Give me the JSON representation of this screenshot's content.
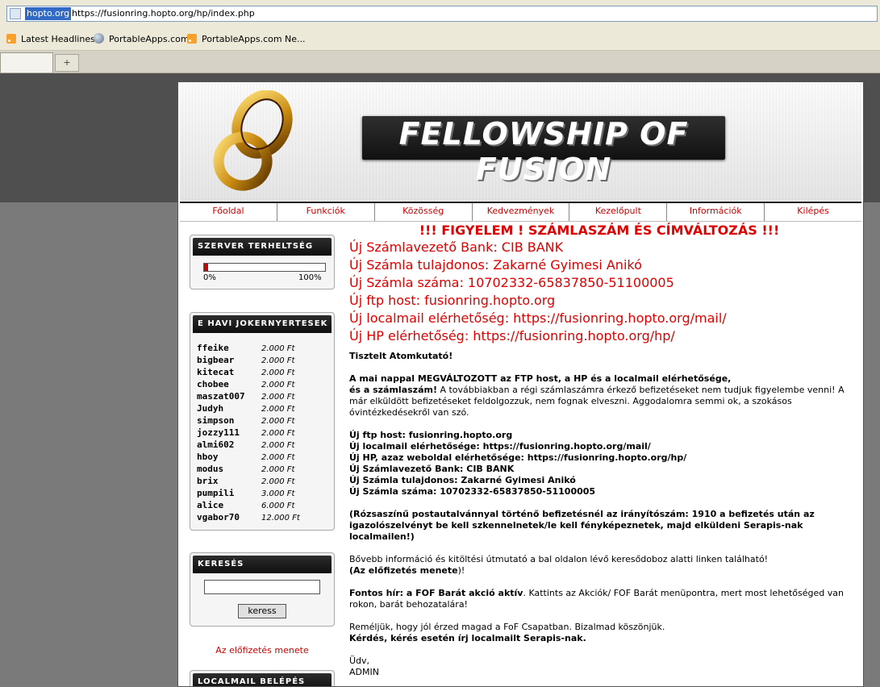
{
  "browser": {
    "host_highlight": "hopto.org",
    "url": "https://fusionring.hopto.org/hp/index.php",
    "bookmarks": [
      "Latest Headlines",
      "PortableApps.com",
      "PortableApps.com Ne..."
    ],
    "new_tab_symbol": "+"
  },
  "header": {
    "banner_text": "FELLOWSHIP OF FUSION"
  },
  "nav": [
    "Főoldal",
    "Funkciók",
    "Közösség",
    "Kedvezmények",
    "Kezelőpult",
    "Információk",
    "Kilépés"
  ],
  "sidebar": {
    "load_box": {
      "title": "SZERVER TERHELTSÉG",
      "min_label": "0%",
      "max_label": "100%",
      "load_fraction": 0.03
    },
    "winners_box": {
      "title": "E HAVI JOKERNYERTESEK",
      "rows": [
        {
          "name": "ffeike",
          "amount": "2.000 Ft"
        },
        {
          "name": "bigbear",
          "amount": "2.000 Ft"
        },
        {
          "name": "kitecat",
          "amount": "2.000 Ft"
        },
        {
          "name": "chobee",
          "amount": "2.000 Ft"
        },
        {
          "name": "maszat007",
          "amount": "2.000 Ft"
        },
        {
          "name": "Judyh",
          "amount": "2.000 Ft"
        },
        {
          "name": "simpson",
          "amount": "2.000 Ft"
        },
        {
          "name": "jozzy111",
          "amount": "2.000 Ft"
        },
        {
          "name": "almi602",
          "amount": "2.000 Ft"
        },
        {
          "name": "hboy",
          "amount": "2.000 Ft"
        },
        {
          "name": "modus",
          "amount": "2.000 Ft"
        },
        {
          "name": "brix",
          "amount": "2.000 Ft"
        },
        {
          "name": "pumpili",
          "amount": "3.000 Ft"
        },
        {
          "name": "alice",
          "amount": "6.000 Ft"
        },
        {
          "name": "vgabor70",
          "amount": "12.000 Ft"
        }
      ]
    },
    "search_box": {
      "title": "KERESÉS",
      "input_value": "",
      "button_label": "keress"
    },
    "subscription_link": "Az előfizetés menete",
    "localmail_box": {
      "title": "LOCALMAIL BELÉPÉS"
    }
  },
  "main": {
    "warning_title": "!!! FIGYELEM ! SZÁMLASZÁM ÉS CÍMVÁLTOZÁS !!!",
    "red_lines": [
      "Új Számlavezető Bank: CIB BANK",
      "Új Számla tulajdonos: Zakarné Gyimesi Anikó",
      "Új Számla száma: 10702332-65837850-51100005",
      "Új ftp host: fusionring.hopto.org",
      "Új localmail elérhetőség: https://fusionring.hopto.org/mail/",
      "Új HP elérhetőség: https://fusionring.hopto.org/hp/"
    ],
    "greeting": "Tisztelt Atomkutató!",
    "para1_bold1": "A mai nappal MEGVÁLTOZOTT az FTP host, a HP és a localmail elérhetősége,",
    "para1_bold2": "és a számlaszám!",
    "para1_rest": " A továbbiakban a régi számlaszámra érkező befizetéseket nem tudjuk figyelembe venni! A már elküldött befizetéseket feldolgozzuk, nem fognak elveszni. Aggodalomra semmi ok, a szokásos óvintézkedésekről van szó.",
    "details": [
      "Új ftp host: fusionring.hopto.org",
      "Új localmail elérhetősége: https://fusionring.hopto.org/mail/",
      "Új HP, azaz weboldal elérhetősége: https://fusionring.hopto.org/hp/",
      "Új Számlavezető Bank: CIB BANK",
      "Új Számla tulajdonos: Zakarné Gyimesi Anikó",
      "Új Számla száma: 10702332-65837850-51100005"
    ],
    "postal_note": "(Rózsaszínű postautalvánnyal történő befizetésnél az irányítószám: 1910 a befizetés után az igazolószelvényt be kell szkennelnetek/le kell fényképeznetek, majd elküldeni Serapis-nak localmailen!)",
    "info_line": "Bővebb információ és kitöltési útmutató a bal oldalon lévő keresődoboz alatti linken található!",
    "info_link": "(Az előfizetés menete",
    "info_link_end": ")!",
    "news_bold": "Fontos hír: a FOF Barát akció aktív",
    "news_rest": ". Kattints az Akciók/ FOF Barát menüpontra, mert most lehetőséged van rokon, barát behozatalára!",
    "closing": "Reméljük, hogy jól érzed magad a FoF Csapatban. Bizalmad köszönjük.",
    "closing_bold": "Kérdés, kérés esetén írj localmailt Serapis-nak.",
    "sign1": "Üdv,",
    "sign2": "ADMIN"
  }
}
